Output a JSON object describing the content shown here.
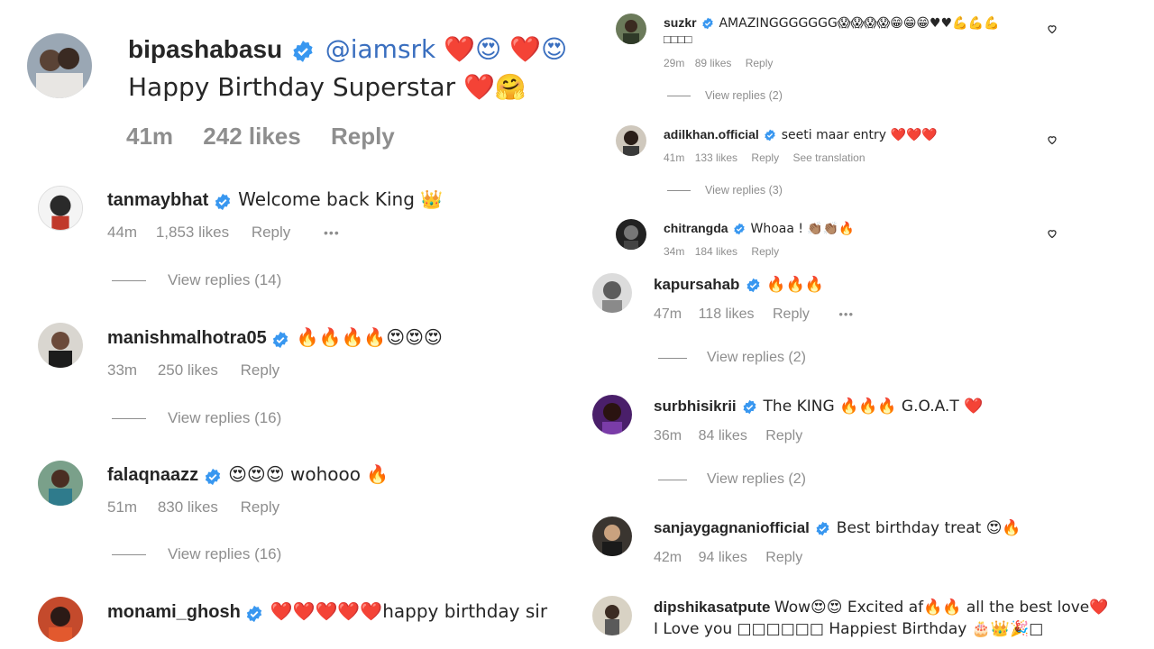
{
  "colors": {
    "text": "#262626",
    "muted": "#8e8e8e",
    "verified": "#3897f0",
    "heart": "#e0102a"
  },
  "comments": [
    {
      "user": "bipashabasu",
      "message_line1": "@iamsrk ❤️😍 ❤️😍",
      "message_line2": "Happy Birthday Superstar ❤️🤗",
      "time": "41m",
      "likes": "242 likes",
      "reply": "Reply"
    },
    {
      "user": "tanmaybhat",
      "message": "Welcome back King 👑",
      "time": "44m",
      "likes": "1,853 likes",
      "reply": "Reply",
      "more": "•••",
      "view_replies": "View replies (14)"
    },
    {
      "user": "manishmalhotra05",
      "message": "🔥🔥🔥🔥😍😍😍",
      "time": "33m",
      "likes": "250 likes",
      "reply": "Reply",
      "view_replies": "View replies (16)"
    },
    {
      "user": "falaqnaazz",
      "message": "😍😍😍 wohooo 🔥",
      "time": "51m",
      "likes": "830 likes",
      "reply": "Reply",
      "view_replies": "View replies (16)"
    },
    {
      "user": "monami_ghosh",
      "message": "❤️❤️❤️❤️❤️happy birthday sir"
    },
    {
      "user": "suzkr",
      "message_line1": "AMAZINGGGGGGG😱😱😱😱😁😁😁♥♥💪💪💪",
      "message_line2": "□□□□",
      "time": "29m",
      "likes": "89 likes",
      "reply": "Reply",
      "view_replies": "View replies (2)"
    },
    {
      "user": "adilkhan.official",
      "message": "seeti maar entry ❤️❤️❤️",
      "time": "41m",
      "likes": "133 likes",
      "reply": "Reply",
      "see_translation": "See translation",
      "view_replies": "View replies (3)"
    },
    {
      "user": "chitrangda",
      "message": "Whoaa ! 👏🏽👏🏽🔥",
      "time": "34m",
      "likes": "184 likes",
      "reply": "Reply"
    },
    {
      "user": "kapursahab",
      "message": "🔥🔥🔥",
      "time": "47m",
      "likes": "118 likes",
      "reply": "Reply",
      "more": "•••",
      "view_replies": "View replies (2)"
    },
    {
      "user": "surbhisikrii",
      "message": "The KING 🔥🔥🔥 G.O.A.T ❤️",
      "time": "36m",
      "likes": "84 likes",
      "reply": "Reply",
      "view_replies": "View replies (2)"
    },
    {
      "user": "sanjaygagnaniofficial",
      "message": "Best birthday treat 😍🔥",
      "time": "42m",
      "likes": "94 likes",
      "reply": "Reply"
    },
    {
      "user": "dipshikasatpute",
      "message_line1": "Wow😍😍 Excited af🔥🔥 all the best love❤️",
      "message_line2": "I Love you □□□□□□ Happiest Birthday 🎂👑🎉□"
    }
  ]
}
